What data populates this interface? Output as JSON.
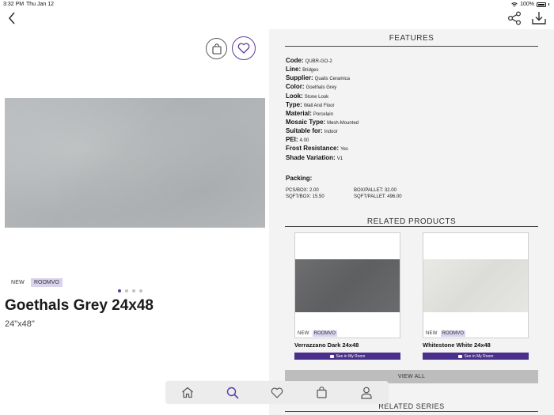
{
  "status_bar": {
    "time": "3:32 PM",
    "date": "Thu Jan 12",
    "battery": "100%"
  },
  "product": {
    "name": "Goethals Grey 24x48",
    "size": "24\"x48\"",
    "tags": {
      "new": "NEW",
      "roomvo": "ROOMVO"
    },
    "carousel": {
      "count": 4,
      "active": 1
    }
  },
  "features": {
    "title": "FEATURES",
    "items": [
      {
        "label": "Code:",
        "value": "QUBR-GO-2"
      },
      {
        "label": "Line:",
        "value": "Bridges"
      },
      {
        "label": "Supplier:",
        "value": "Qualis Ceramica"
      },
      {
        "label": "Color:",
        "value": "Goethals Grey"
      },
      {
        "label": "Look:",
        "value": "Stone Look"
      },
      {
        "label": "Type:",
        "value": "Wall And Floor"
      },
      {
        "label": "Material:",
        "value": "Porcelain"
      },
      {
        "label": "Mosaic Type:",
        "value": "Mesh-Mounted"
      },
      {
        "label": "Suitable for:",
        "value": "Indoor"
      },
      {
        "label": "PEI:",
        "value": "4.00"
      },
      {
        "label": "Frost Resistance:",
        "value": "Yes"
      },
      {
        "label": "Shade Variation:",
        "value": "V1"
      }
    ]
  },
  "packing": {
    "title": "Packing:",
    "pcs_box": "PCS/BOX: 2.00",
    "sqft_box": "SQFT/BOX: 15.50",
    "box_pallet": "BOX/PALLET: 32.00",
    "sqft_pallet": "SQFT/PALLET: 496.00"
  },
  "related_products": {
    "title": "RELATED PRODUCTS",
    "items": [
      {
        "name": "Verrazzano Dark 24x48",
        "tag_new": "NEW",
        "tag_roomvo": "ROOMVO",
        "button": "See in My Room"
      },
      {
        "name": "Whitestone White 24x48",
        "tag_new": "NEW",
        "tag_roomvo": "ROOMVO",
        "button": "See in My Room"
      }
    ],
    "view_all": "VIEW ALL"
  },
  "related_series": {
    "title": "RELATED SERIES"
  },
  "colors": {
    "accent": "#5b3aa6",
    "button": "#4a2f8c",
    "panel": "#f3f3f3"
  },
  "icons": {
    "back": "chevron-left-icon",
    "share": "share-icon",
    "download": "download-icon",
    "bag": "shopping-bag-icon",
    "favorite": "heart-icon",
    "nav": [
      "home-icon",
      "search-icon",
      "heart-icon",
      "shopping-bag-icon",
      "user-icon"
    ]
  }
}
